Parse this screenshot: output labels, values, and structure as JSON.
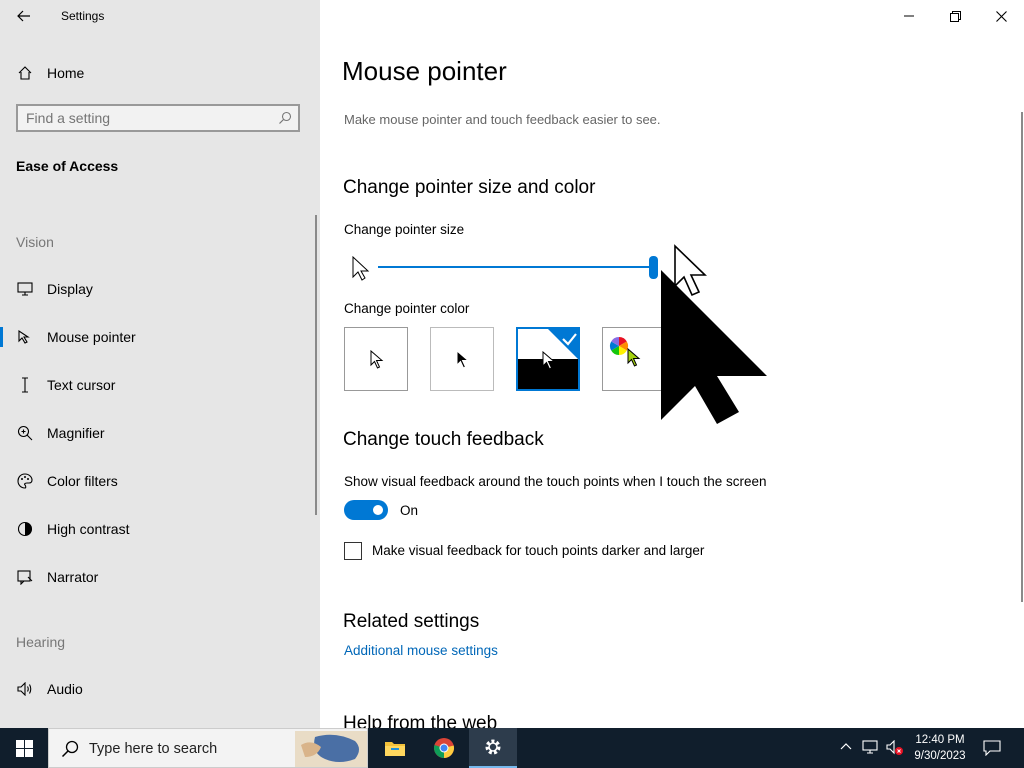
{
  "window": {
    "title": "Settings",
    "controls": {
      "minimize": "minimize-icon",
      "restore": "restore-icon",
      "close": "close-icon"
    }
  },
  "sidebar": {
    "home_label": "Home",
    "search_placeholder": "Find a setting",
    "group_title": "Ease of Access",
    "vision_heading": "Vision",
    "vision_items": [
      {
        "label": "Display",
        "icon": "monitor-icon"
      },
      {
        "label": "Mouse pointer",
        "icon": "mouse-pointer-icon",
        "selected": true
      },
      {
        "label": "Text cursor",
        "icon": "text-cursor-icon"
      },
      {
        "label": "Magnifier",
        "icon": "magnifier-icon"
      },
      {
        "label": "Color filters",
        "icon": "color-filters-icon"
      },
      {
        "label": "High contrast",
        "icon": "high-contrast-icon"
      },
      {
        "label": "Narrator",
        "icon": "narrator-icon"
      }
    ],
    "hearing_heading": "Hearing",
    "hearing_items": [
      {
        "label": "Audio",
        "icon": "audio-icon"
      }
    ]
  },
  "main": {
    "title": "Mouse pointer",
    "description": "Make mouse pointer and touch feedback easier to see.",
    "size_color_heading": "Change pointer size and color",
    "pointer_size_label": "Change pointer size",
    "pointer_size_value": 15,
    "pointer_size_range": [
      1,
      15
    ],
    "pointer_color_label": "Change pointer color",
    "pointer_color_options": [
      {
        "name": "white",
        "selected": false
      },
      {
        "name": "black",
        "selected": false
      },
      {
        "name": "inverted",
        "selected": true
      },
      {
        "name": "custom",
        "selected": false
      }
    ],
    "touch_heading": "Change touch feedback",
    "touch_label": "Show visual feedback around the touch points when I touch the screen",
    "touch_toggle_state": "On",
    "touch_darker_label": "Make visual feedback for touch points darker and larger",
    "touch_darker_checked": false,
    "related_heading": "Related settings",
    "related_link": "Additional mouse settings",
    "help_heading": "Help from the web"
  },
  "taskbar": {
    "search_placeholder": "Type here to search",
    "apps": [
      "file-explorer-icon",
      "chrome-icon",
      "settings-icon"
    ],
    "time": "12:40 PM",
    "date": "9/30/2023"
  },
  "colors": {
    "accent": "#0078d4",
    "sidebar_bg": "#e6e6e6",
    "taskbar_bg": "#101e2c",
    "link": "#0067b8"
  }
}
